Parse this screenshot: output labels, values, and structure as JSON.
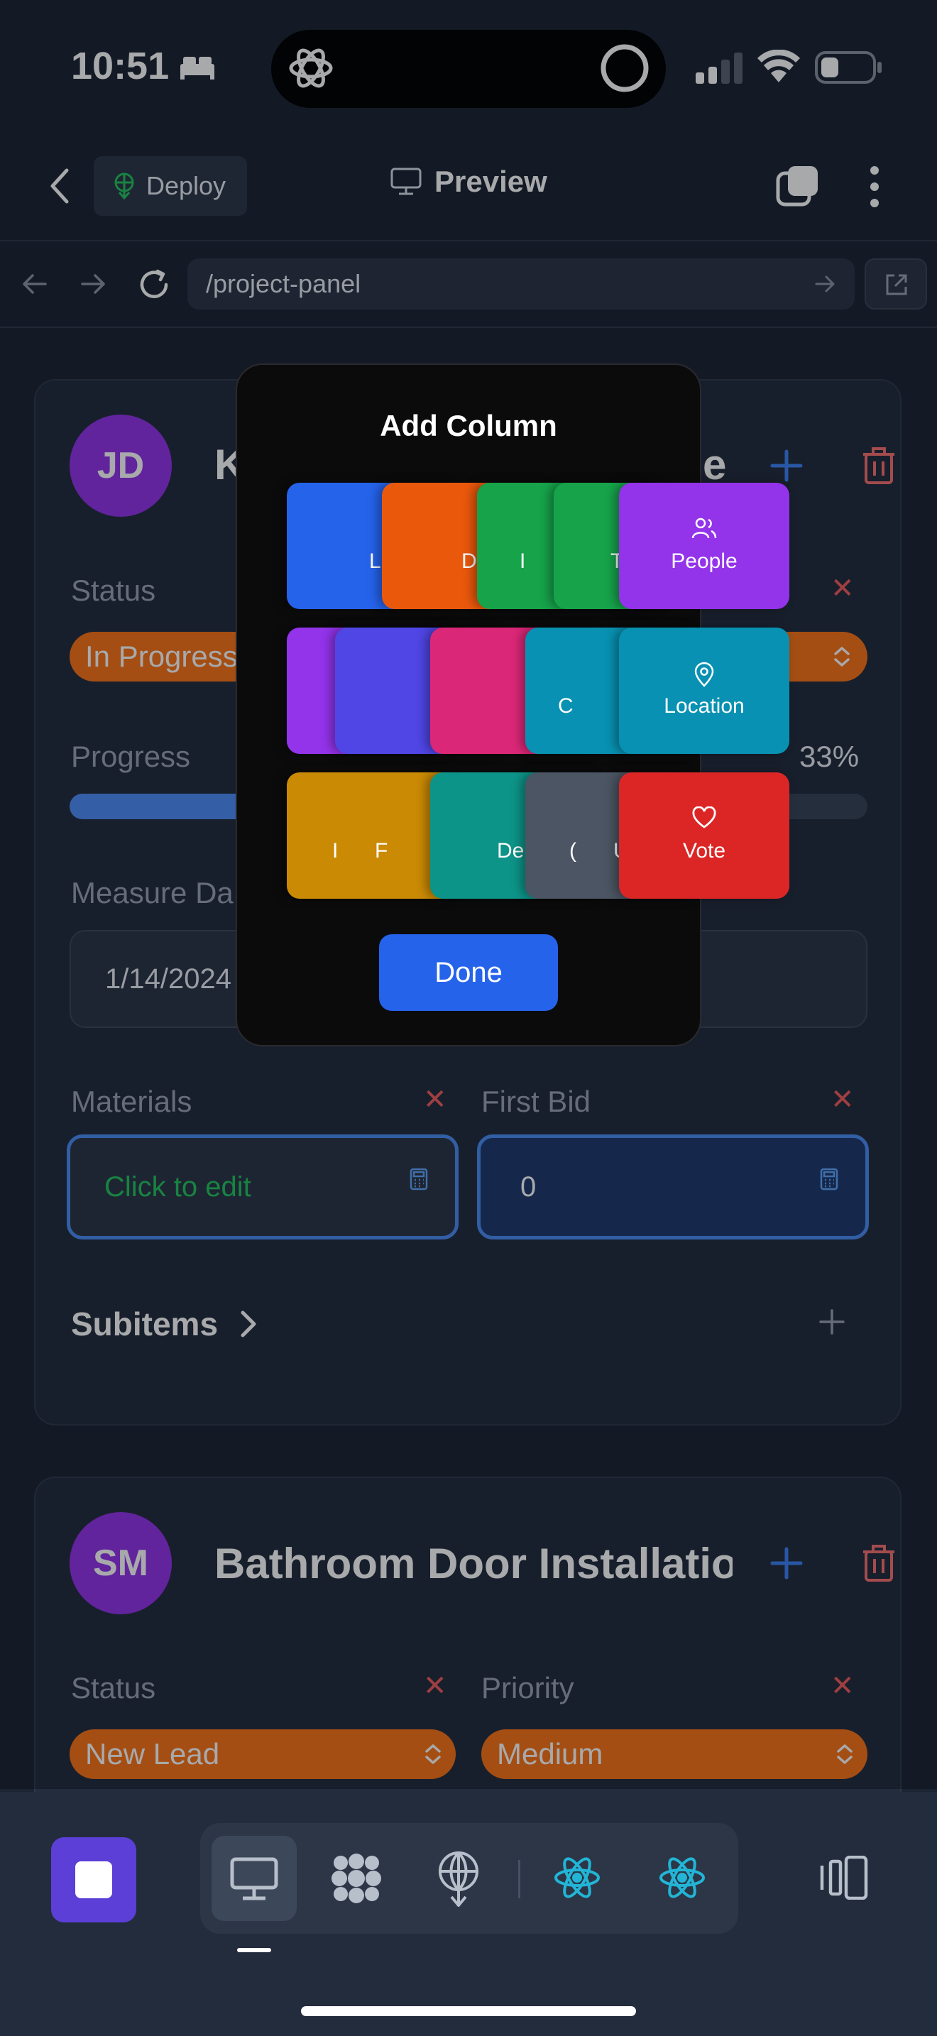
{
  "status_bar": {
    "time": "10:51"
  },
  "header": {
    "deploy_label": "Deploy",
    "preview_label": "Preview"
  },
  "browser": {
    "url": "/project-panel"
  },
  "item1": {
    "initials": "JD",
    "title_fragment_start": "K",
    "title_fragment_end": "e",
    "status_label": "Status",
    "status_value": "In Progress",
    "progress_label": "Progress",
    "progress_value": "33%",
    "progress_fraction": 0.33,
    "measure_label": "Measure Da",
    "measure_value": "1/14/2024",
    "materials_label": "Materials",
    "materials_value": "Click to edit",
    "first_bid_label": "First Bid",
    "first_bid_value": "0",
    "subitems_label": "Subitems"
  },
  "item2": {
    "initials": "SM",
    "title": "Bathroom Door Installatio",
    "status_label": "Status",
    "status_value": "New Lead",
    "priority_label": "Priority",
    "priority_value": "Medium"
  },
  "modal": {
    "title": "Add Column",
    "rows": [
      [
        {
          "label": "L",
          "color": "#2563eb"
        },
        {
          "label": "D",
          "color": "#ea580c"
        },
        {
          "label": "I",
          "color": "#16a34a"
        },
        {
          "label": "T",
          "color": "#16a34a"
        },
        {
          "label": "People",
          "color": "#9333ea",
          "icon": "people-icon"
        }
      ],
      [
        {
          "label": "",
          "color": "#9333ea"
        },
        {
          "label": "",
          "color": "#4f46e5"
        },
        {
          "label": "",
          "color": "#db2777"
        },
        {
          "label": "C",
          "color": "#0891b2"
        },
        {
          "label": "Location",
          "color": "#0891b2",
          "icon": "location-pin-icon"
        }
      ],
      [
        {
          "label": "I",
          "color": "#ca8a04"
        },
        {
          "label": "F",
          "color": "#ca8a04"
        },
        {
          "label": "De",
          "color": "#0d9488"
        },
        {
          "label": "(",
          "color": "#4b5563"
        },
        {
          "label": "U",
          "color": "#4b5563"
        },
        {
          "label": "Vote",
          "color": "#dc2626",
          "icon": "heart-icon"
        }
      ]
    ],
    "done_label": "Done"
  },
  "colors": {
    "background": "#1b2432",
    "card": "#222c3c",
    "accent_blue": "#3b82f6",
    "orange_pill": "#f97316",
    "avatar_purple": "#9333ea",
    "delete_red": "#f87171"
  }
}
